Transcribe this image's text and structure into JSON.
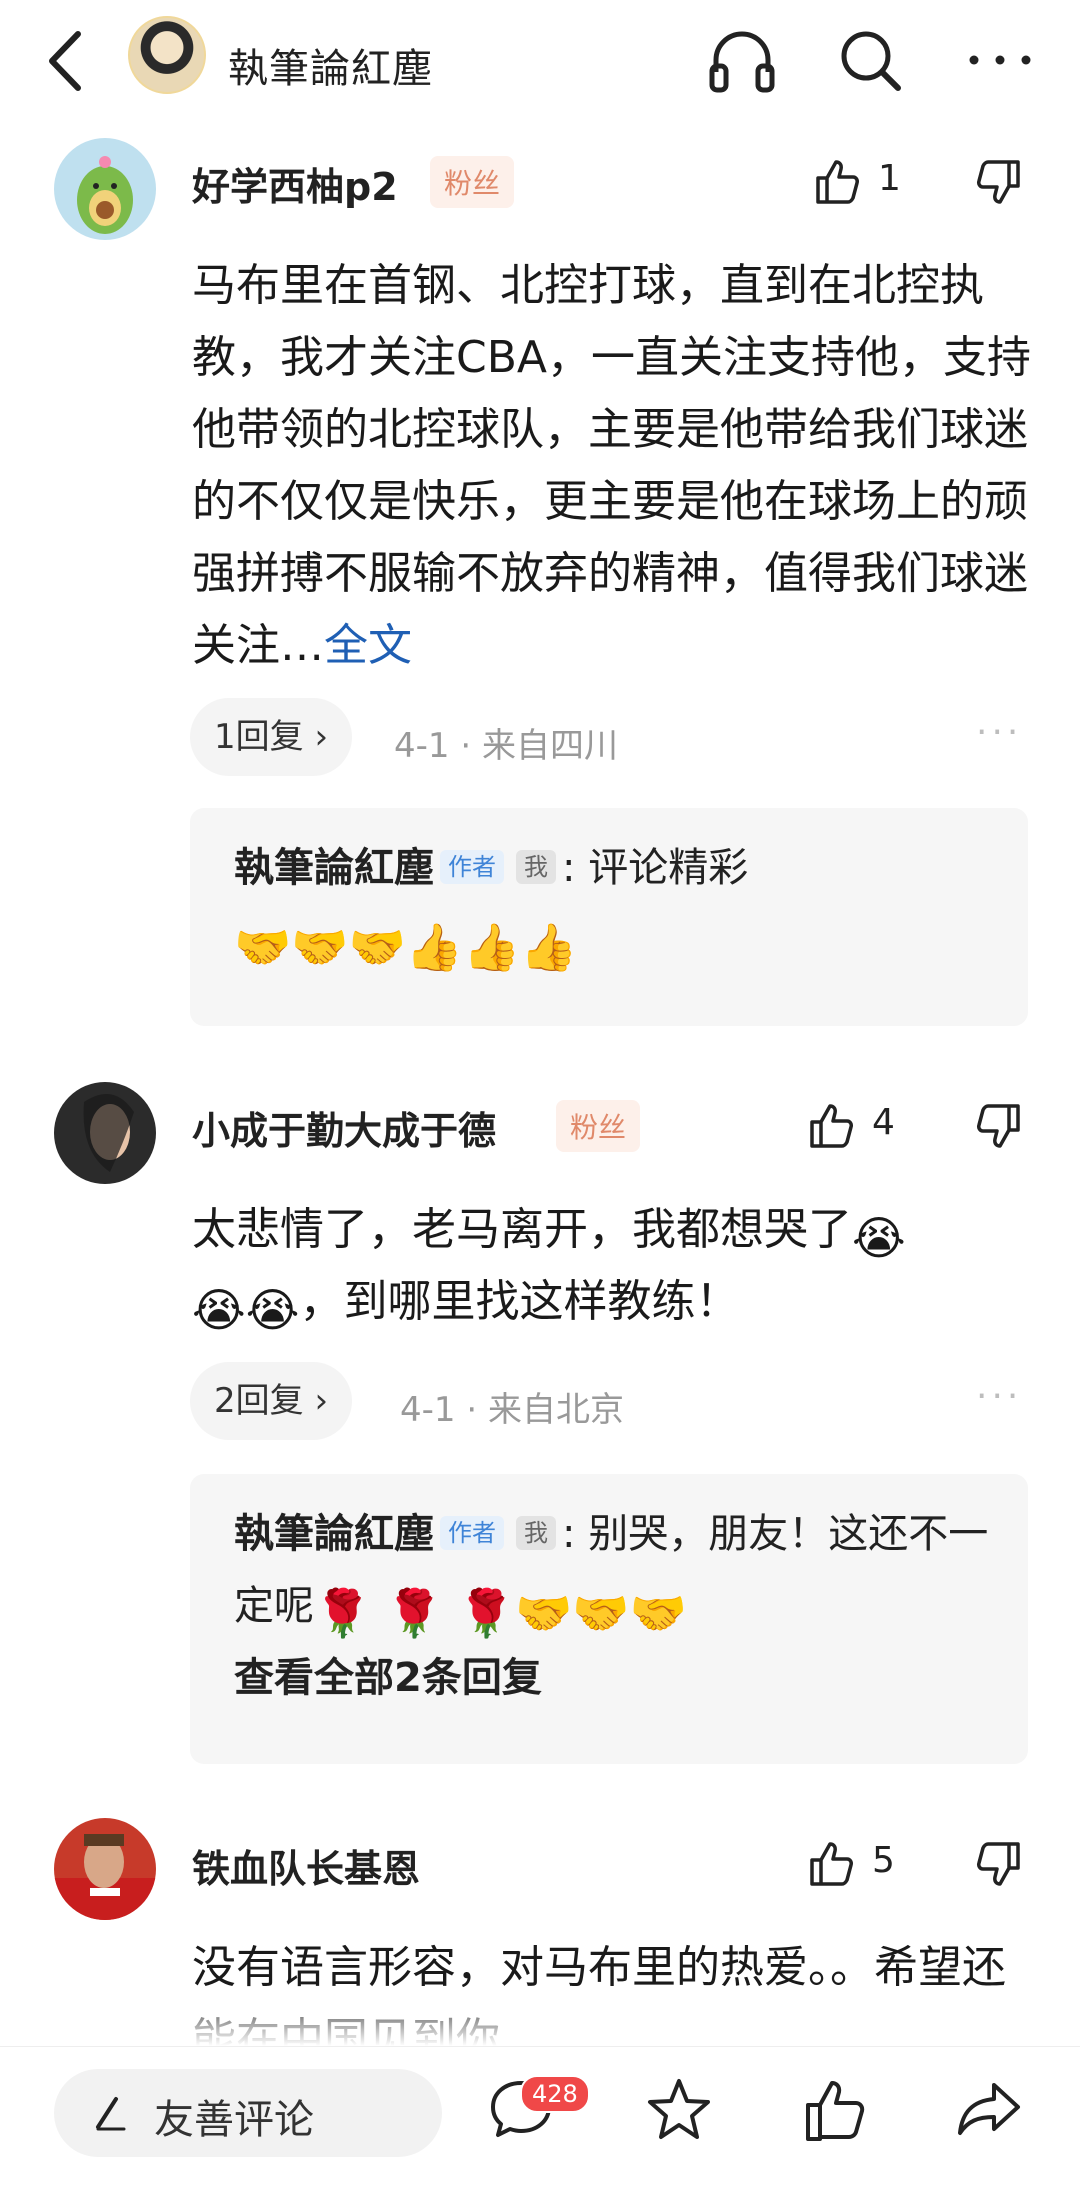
{
  "header": {
    "title": "執筆論紅塵",
    "icons": [
      "back-icon",
      "headphones-icon",
      "search-icon",
      "more-icon"
    ]
  },
  "comments": [
    {
      "username": "好学西柚p2",
      "badge": "粉丝",
      "likes": "1",
      "text": "马布里在首钢、北控打球，直到在北控执教，我才关注CBA，一直关注支持他，支持他带领的北控球队，主要是他带给我们球迷的不仅仅是快乐，更主要是他在球场上的顽强拼搏不服输不放弃的精神，值得我们球迷关注…",
      "fulltext_link": "全文",
      "reply_count": "1回复",
      "date": "4-1",
      "location": "来自四川",
      "reply": {
        "name": "執筆論紅塵",
        "tag_author": "作者",
        "tag_me": "我",
        "text": ": 评论精彩",
        "emojis": "🤝🤝🤝👍👍👍"
      }
    },
    {
      "username": "小成于勤大成于德",
      "badge": "粉丝",
      "likes": "4",
      "text": "太悲情了，老马离开，我都想哭了",
      "text_after": "，到哪里找这样教练！",
      "emojis_inline": "😭",
      "emojis_line2": "😭😭",
      "reply_count": "2回复",
      "date": "4-1",
      "location": "来自北京",
      "reply": {
        "name": "執筆論紅塵",
        "tag_author": "作者",
        "tag_me": "我",
        "text": ": 别哭，朋友！这还不一定呢",
        "emojis": "🌹 🌹 🌹🤝🤝🤝",
        "view_all": "查看全部2条回复"
      }
    },
    {
      "username": "铁血队长基恩",
      "likes": "5",
      "text": "没有语言形容，对马布里的热爱。。希望还能在中国见到你"
    }
  ],
  "bottom_bar": {
    "input_placeholder": "友善评论",
    "comment_count": "428",
    "icons": [
      "pen-icon",
      "comment-icon",
      "star-icon",
      "thumbs-up-icon",
      "share-icon"
    ]
  },
  "colors": {
    "link": "#1f5fb4",
    "fan_badge": "#e0896a",
    "author_tag": "#3f84d7",
    "badge_red": "#f04848"
  }
}
